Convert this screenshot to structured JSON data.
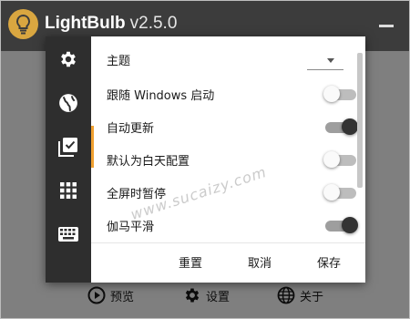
{
  "app": {
    "name": "LightBulb",
    "version": "v2.5.0",
    "logo_icon": "lightbulb-icon"
  },
  "bottom_bar": {
    "items": [
      {
        "label": "预览",
        "icon": "play-circle-icon"
      },
      {
        "label": "设置",
        "icon": "gear-icon"
      },
      {
        "label": "关于",
        "icon": "globe-icon"
      }
    ]
  },
  "settings_dialog": {
    "sidebar": {
      "items": [
        {
          "icon": "gear-icon"
        },
        {
          "icon": "globe-icon"
        },
        {
          "icon": "checkbox-list-icon"
        },
        {
          "icon": "grid-icon"
        },
        {
          "icon": "keyboard-icon"
        }
      ],
      "active_index": 2
    },
    "rows": [
      {
        "label": "主题",
        "control": "select",
        "value": ""
      },
      {
        "label": "跟随 Windows 启动",
        "control": "toggle",
        "on": false
      },
      {
        "label": "自动更新",
        "control": "toggle",
        "on": true
      },
      {
        "label": "默认为白天配置",
        "control": "toggle",
        "on": false
      },
      {
        "label": "全屏时暂停",
        "control": "toggle",
        "on": false
      },
      {
        "label": "伽马平滑",
        "control": "toggle",
        "on": true
      }
    ],
    "buttons": {
      "reset": "重置",
      "cancel": "取消",
      "save": "保存"
    }
  },
  "watermark": "www.sucaizy.com",
  "colors": {
    "titlebar": "#3c3c3c",
    "sidebar": "#2e2e2e",
    "accent": "#f0a030",
    "logo": "#d9a640"
  }
}
